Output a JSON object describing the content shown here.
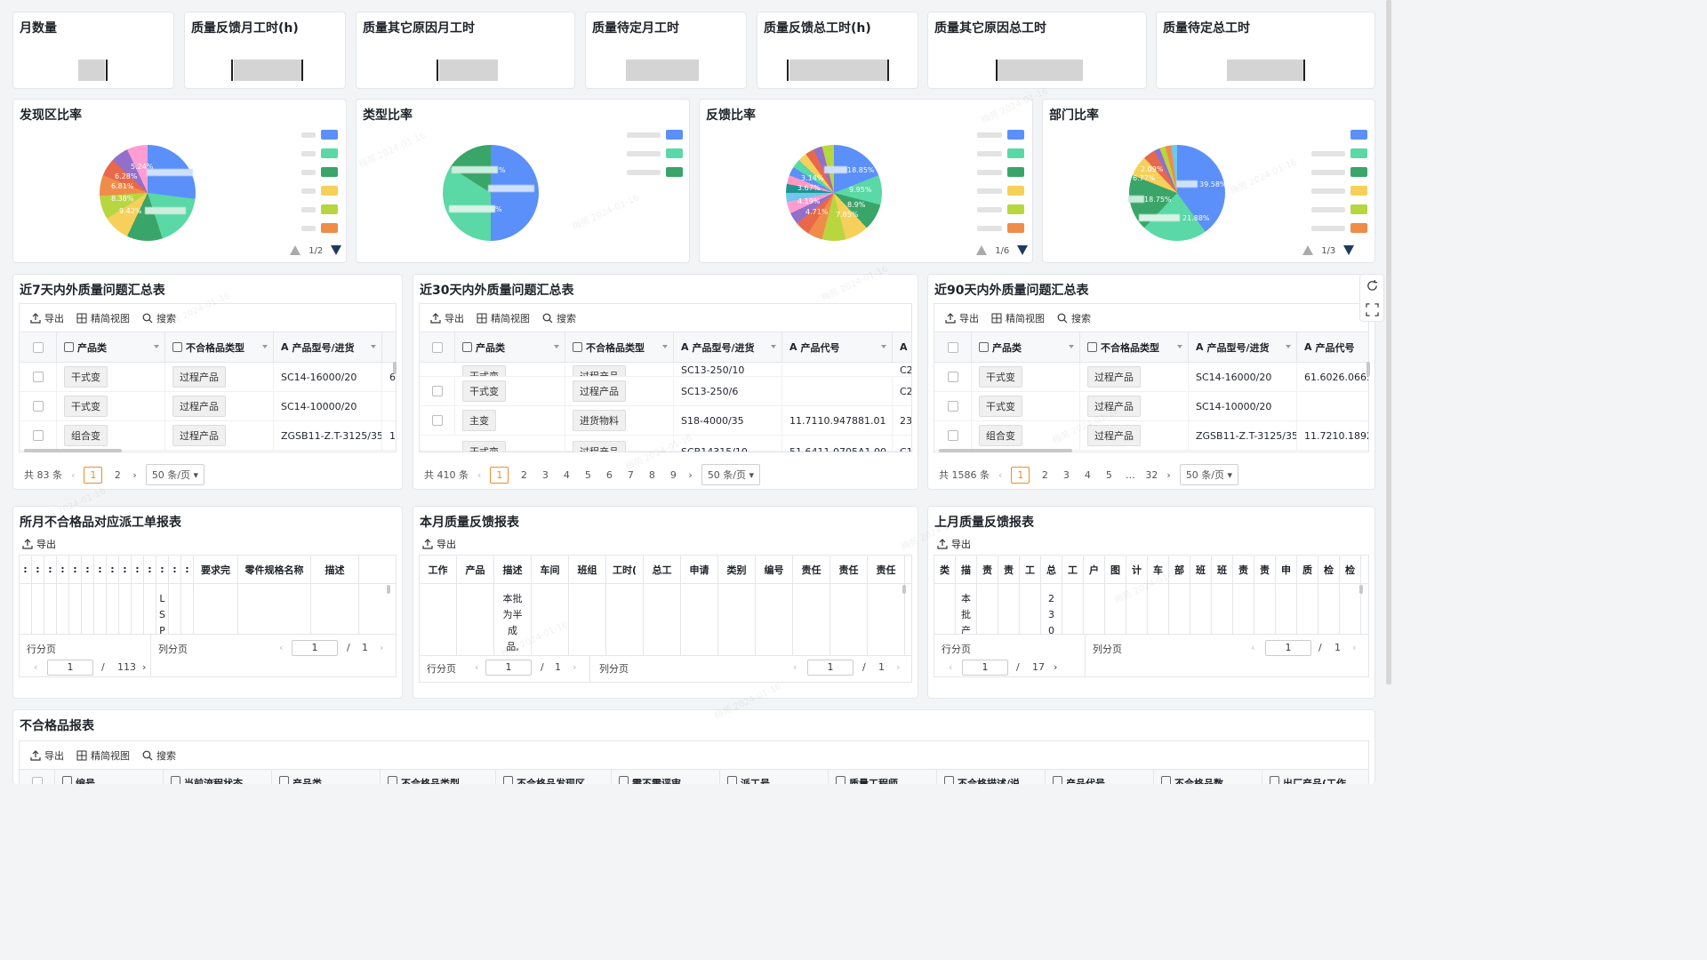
{
  "kpis": [
    {
      "title": "月数量"
    },
    {
      "title": "质量反馈月工时(h)"
    },
    {
      "title": "质量其它原因月工时"
    },
    {
      "title": "质量待定月工时"
    },
    {
      "title": "质量反馈总工时(h)"
    },
    {
      "title": "质量其它原因总工时"
    },
    {
      "title": "质量待定总工时"
    }
  ],
  "pies": [
    {
      "title": "发现区比率",
      "page": "1/2",
      "labels": [
        "5.24%",
        "6.28%",
        "6.81%",
        "8.38%",
        "9.42%"
      ]
    },
    {
      "title": "类型比率",
      "page": "",
      "labels": [
        "%",
        "%"
      ]
    },
    {
      "title": "反馈比率",
      "page": "1/6",
      "labels": [
        "18.85%",
        "3.14%",
        "3.67%",
        "9.95%",
        "4.19%",
        "8.9%",
        "4.71%",
        "7.85%"
      ]
    },
    {
      "title": "部门比率",
      "page": "1/3",
      "labels": [
        "2.09%",
        "6.77%",
        "39.58%",
        "18.75%",
        "21.88%"
      ]
    }
  ],
  "colors": {
    "accent": "#f08c2a",
    "pie": [
      "#5b8ff9",
      "#5ad8a6",
      "#3aa568",
      "#f6d05a",
      "#b8d640",
      "#f08c4a",
      "#e8684a",
      "#9270ca",
      "#ff9dd3",
      "#6dc8ec"
    ]
  },
  "toolbar": {
    "export": "导出",
    "compact": "精简视图",
    "search": "搜索"
  },
  "t7": {
    "title": "近7天内外质量问题汇总表",
    "headers": [
      "产品类",
      "不合格品类型",
      "产品型号/进货"
    ],
    "rows": [
      [
        "干式变",
        "过程产品",
        "SC14-16000/20",
        "6"
      ],
      [
        "干式变",
        "过程产品",
        "SC14-10000/20",
        ""
      ],
      [
        "组合变",
        "过程产品",
        "ZGSB11-Z.T-3125/35",
        "1"
      ]
    ],
    "total": "共 83 条",
    "pages": [
      "1",
      "2"
    ],
    "size": "50 条/页"
  },
  "t30": {
    "title": "近30天内外质量问题汇总表",
    "headers": [
      "产品类",
      "不合格品类型",
      "产品型号/进货",
      "产品代号",
      "A"
    ],
    "rows": [
      [
        "干式变",
        "过程产品",
        "SC13-250/10",
        "",
        "C2"
      ],
      [
        "干式变",
        "过程产品",
        "SC13-250/6",
        "",
        "C2"
      ],
      [
        "主变",
        "进货物料",
        "S18-4000/35",
        "11.7110.947881.01",
        "23"
      ],
      [
        "干式变",
        "过程产品",
        "SCB14315/10",
        "51.6411.0705A1.00",
        "C1"
      ]
    ],
    "total": "共 410 条",
    "pages": [
      "1",
      "2",
      "3",
      "4",
      "5",
      "6",
      "7",
      "8",
      "9"
    ],
    "size": "50 条/页"
  },
  "t90": {
    "title": "近90天内外质量问题汇总表",
    "headers": [
      "产品类",
      "不合格品类型",
      "产品型号/进货",
      "产品代号"
    ],
    "rows": [
      [
        "干式变",
        "过程产品",
        "SC14-16000/20",
        "61.6026.0665."
      ],
      [
        "干式变",
        "过程产品",
        "SC14-10000/20",
        ""
      ],
      [
        "组合变",
        "过程产品",
        "ZGSB11-Z.T-3125/35",
        "11.7210.1892."
      ]
    ],
    "total": "共 1586 条",
    "pages": [
      "1",
      "2",
      "3",
      "4",
      "5",
      "…",
      "32"
    ],
    "size": "50 条/页"
  },
  "rep1": {
    "title": "所月不合格品对应派工单报表",
    "headers": [
      "要求完",
      "零件规格名称",
      "描述"
    ],
    "cell": [
      "L",
      "S",
      "P"
    ],
    "row_label": "行分页",
    "col_label": "列分页",
    "row_page": "1",
    "row_total": "113",
    "col_page": "1",
    "col_total": "1"
  },
  "rep2": {
    "title": "本月质量反馈报表",
    "headers": [
      "工作",
      "产品",
      "描述",
      "车间",
      "班组",
      "工时(",
      "总工",
      "申请",
      "类别",
      "编号",
      "责任",
      "责任",
      "责任"
    ],
    "cell": [
      "本批",
      "为半",
      "成",
      "品,"
    ],
    "row_label": "行分页",
    "col_label": "列分页",
    "row_page": "1",
    "row_total": "1",
    "col_page": "1",
    "col_total": "1"
  },
  "rep3": {
    "title": "上月质量反馈报表",
    "headers": [
      "类",
      "描",
      "责",
      "责",
      "工",
      "总",
      "工",
      "户",
      "图",
      "计",
      "车",
      "部",
      "班",
      "班",
      "责",
      "责",
      "申",
      "质",
      "检",
      "检"
    ],
    "cell_a": [
      "本",
      "批",
      "产"
    ],
    "cell_b": [
      "2",
      "3",
      "0"
    ],
    "row_label": "行分页",
    "col_label": "列分页",
    "row_page": "1",
    "row_total": "17",
    "col_page": "1",
    "col_total": "1"
  },
  "bottom": {
    "title": "不合格品报表",
    "headers": [
      "编号",
      "当前流程状态",
      "产品类",
      "不合格品类型",
      "不合格品发现区",
      "需不需评审",
      "派工号",
      "质量工程师",
      "不合格描述/说",
      "产品代号",
      "不合格品数",
      "出厂产品(工作"
    ]
  },
  "sep": "/",
  "watermark": "梅苑 2024-01-16"
}
